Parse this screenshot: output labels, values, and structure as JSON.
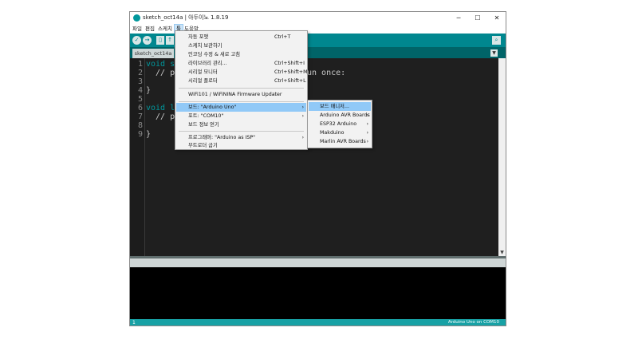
{
  "window": {
    "title": "sketch_oct14a | 아두이노 1.8.19",
    "minimize": "─",
    "maximize": "☐",
    "close": "✕"
  },
  "menubar": [
    "파일",
    "편집",
    "스케치",
    "툴",
    "도움말"
  ],
  "toolbar": {
    "verify_icon": "✓",
    "upload_icon": "→",
    "new_icon": "▯",
    "open_icon": "↑",
    "serial_icon": "⌕"
  },
  "tabs": {
    "active": "sketch_oct14a",
    "menu_icon": "▼"
  },
  "editor": {
    "line_numbers": [
      "1",
      "2",
      "3",
      "4",
      "5",
      "6",
      "7",
      "8",
      "9"
    ],
    "visible_code": [
      {
        "kw": "void s",
        "rest": ""
      },
      {
        "kw": "",
        "rest": "  // p"
      },
      {
        "kw": "",
        "rest": ""
      },
      {
        "kw": "",
        "rest": "}"
      },
      {
        "kw": "",
        "rest": ""
      },
      {
        "kw": "void l",
        "rest": ""
      },
      {
        "kw": "",
        "rest": "  // p"
      },
      {
        "kw": "",
        "rest": ""
      },
      {
        "kw": "",
        "rest": "}"
      }
    ],
    "visible_fragment": "un once:"
  },
  "status": {
    "line": "1",
    "board_port": "Arduino Uno on COM10"
  },
  "tools_menu": {
    "items": [
      {
        "label": "자동 포맷",
        "shortcut": "Ctrl+T"
      },
      {
        "label": "스케치 보관하기",
        "shortcut": ""
      },
      {
        "label": "인코딩 수정 & 새로 고침",
        "shortcut": ""
      },
      {
        "label": "라이브러리 관리...",
        "shortcut": "Ctrl+Shift+I"
      },
      {
        "label": "시리얼 모니터",
        "shortcut": "Ctrl+Shift+M"
      },
      {
        "label": "시리얼 플로터",
        "shortcut": "Ctrl+Shift+L"
      },
      {
        "label": "WiFi101 / WiFiNINA Firmware Updater",
        "shortcut": ""
      },
      {
        "label": "보드: \"Arduino Uno\"",
        "shortcut": ""
      },
      {
        "label": "포트: \"COM10\"",
        "shortcut": ""
      },
      {
        "label": "보드 정보 얻기",
        "shortcut": ""
      },
      {
        "label": "프로그래머: \"Arduino as ISP\"",
        "shortcut": ""
      },
      {
        "label": "부트로더 굽기",
        "shortcut": ""
      }
    ],
    "submenu_arrow": "›"
  },
  "board_submenu": {
    "items": [
      "보드 매니저...",
      "Arduino AVR Boards",
      "ESP32 Arduino",
      "Makduino",
      "Marlin AVR Boards"
    ]
  },
  "colors": {
    "toolbar": "#00878f",
    "tabbar": "#006468",
    "editor_bg": "#1f1f1f",
    "statusbar": "#17a1a5",
    "menu_highlight": "#91c9f7"
  }
}
